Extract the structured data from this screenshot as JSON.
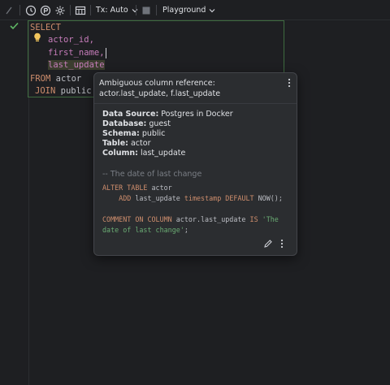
{
  "toolbar": {
    "tx_label": "Tx: Auto",
    "playground_label": "Playground"
  },
  "editor": {
    "line1": "SELECT",
    "line2": "actor_id,",
    "line3": "first_name,",
    "line4": "last_update",
    "line5_kw": "FROM",
    "line5_id": " actor",
    "line6_kw": "JOIN",
    "line6_id": " public.f"
  },
  "popup": {
    "title": "Ambiguous column reference: actor.last_update, f.last_update",
    "meta": [
      {
        "label": "Data Source:",
        "value": " Postgres in Docker"
      },
      {
        "label": "Database:",
        "value": " guest"
      },
      {
        "label": "Schema:",
        "value": " public"
      },
      {
        "label": "Table:",
        "value": " actor"
      },
      {
        "label": "Column:",
        "value": " last_update"
      }
    ],
    "comment": "-- The date of last change",
    "sql": {
      "alter_kw": "ALTER TABLE",
      "alter_id": " actor",
      "add_kw": "ADD",
      "add_id": " last_update ",
      "ts_kw": "timestamp DEFAULT",
      "now": " NOW();",
      "comment_kw": "COMMENT ON COLUMN",
      "comment_id": " actor.last_update ",
      "is_kw": "IS",
      "str1": " 'The",
      "str2": "date of last change'",
      "semi": ";"
    }
  },
  "colors": {
    "keyword": "#cf8e6d",
    "string": "#6aab73",
    "success": "#5fb865",
    "bulb": "#f2c55c"
  }
}
